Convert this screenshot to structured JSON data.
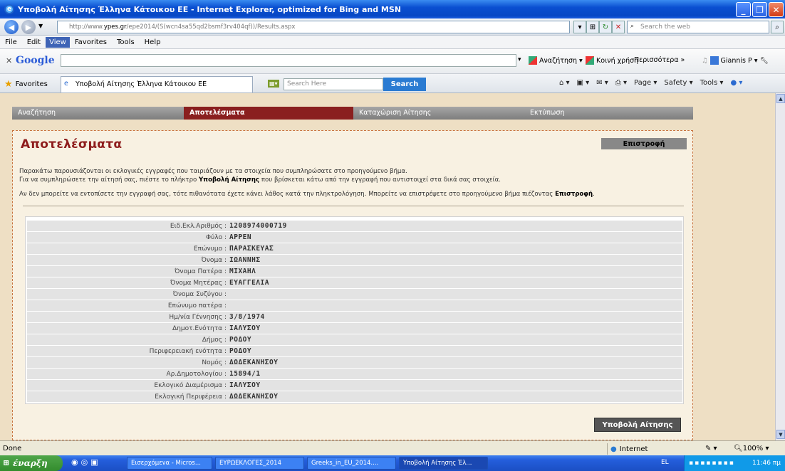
{
  "window": {
    "title": "Υποβολή Αίτησης Έλληνα Κάτοικου ΕΕ - Internet Explorer, optimized for Bing and MSN"
  },
  "address": {
    "url_prefix": "http://www.",
    "url_domain": "ypes.gr",
    "url_rest": "/epe2014/(S(wcn4sa55qd2bsmf3rv404qf))/Results.aspx",
    "web_search_placeholder": "Search the web"
  },
  "menu": {
    "items": [
      "File",
      "Edit",
      "View",
      "Favorites",
      "Tools",
      "Help"
    ]
  },
  "google": {
    "logo": "Google",
    "search": "Αναζήτηση",
    "share": "Κοινή χρήση",
    "more": "Περισσότερα »",
    "user": "Giannis P"
  },
  "favorites": {
    "label": "Favorites",
    "tab_title": "Υποβολή Αίτησης Έλληνα Κάτοικου ΕΕ",
    "site_search_placeholder": "Search Here",
    "search_button": "Search",
    "page": "Page",
    "safety": "Safety",
    "tools": "Tools"
  },
  "nav": {
    "tabs": [
      "Αναζήτηση",
      "Αποτελέσματα",
      "Καταχώριση Αίτησης",
      "Εκτύπωση"
    ]
  },
  "panel": {
    "title": "Αποτελέσματα",
    "back_button": "Επιστροφή",
    "intro1": "Παρακάτω παρουσιάζονται οι εκλογικές εγγραφές που ταιριάζουν με τα στοιχεία που συμπληρώσατε στο προηγούμενο βήμα.",
    "intro2a": "Για να συμπληρώσετε την αίτησή σας, πιέστε το πλήκτρο ",
    "intro2b": "Υποβολή Αίτησης",
    "intro2c": " που βρίσκεται κάτω από την εγγραφή που αντιστοιχεί στα δικά σας στοιχεία.",
    "intro3a": "Αν δεν μπορείτε να εντοπίσετε την εγγραφή σας, τότε πιθανότατα έχετε κάνει λάθος κατά την πληκτρολόγηση. Μπορείτε να επιστρέψετε στο προηγούμενο βήμα πιέζοντας ",
    "intro3b": "Επιστροφή",
    "intro3c": ".",
    "submit_button": "Υποβολή Αίτησης"
  },
  "record": [
    {
      "label": "Ειδ.Εκλ.Αριθμός :",
      "value": "1208974000719"
    },
    {
      "label": "Φύλο :",
      "value": "ΑΡΡΕΝ"
    },
    {
      "label": "Επώνυμο :",
      "value": "ΠΑΡΑΣΚΕΥΑΣ"
    },
    {
      "label": "Όνομα :",
      "value": "ΙΩΑΝΝΗΣ"
    },
    {
      "label": "Όνομα Πατέρα :",
      "value": "ΜΙΧΑΗΛ"
    },
    {
      "label": "Όνομα Μητέρας :",
      "value": "ΕΥΑΓΓΕΛΙΑ"
    },
    {
      "label": "Όνομα Συζύγου :",
      "value": ""
    },
    {
      "label": "Επώνυμο πατέρα :",
      "value": ""
    },
    {
      "label": "Ημ/νία Γέννησης :",
      "value": "3/8/1974"
    },
    {
      "label": "Δημοτ.Ενότητα :",
      "value": "ΙΑΛΥΣΟΥ"
    },
    {
      "label": "Δήμος :",
      "value": "ΡΟΔΟΥ"
    },
    {
      "label": "Περιφερειακή ενότητα :",
      "value": "ΡΟΔΟΥ"
    },
    {
      "label": "Νομός :",
      "value": "ΔΩΔΕΚΑΝΗΣΟΥ"
    },
    {
      "label": "Αρ.Δημοτολογίου :",
      "value": "15894/1"
    },
    {
      "label": "Εκλογικό Διαμέρισμα :",
      "value": "ΙΑΛΥΣΟΥ"
    },
    {
      "label": "Εκλογική Περιφέρεια :",
      "value": "ΔΩΔΕΚΑΝΗΣΟΥ"
    }
  ],
  "status": {
    "left": "Done",
    "zone": "Internet",
    "zoom": "100%"
  },
  "taskbar": {
    "start": "έναρξη",
    "tasks": [
      "Εισερχόμενα - Micros...",
      "ΕΥΡΩΕΚΛΟΓΕΣ_2014",
      "Greeks_in_EU_2014....",
      "Υποβολή Αίτησης Έλ..."
    ],
    "lang": "EL",
    "clock": "11:46 πμ"
  }
}
